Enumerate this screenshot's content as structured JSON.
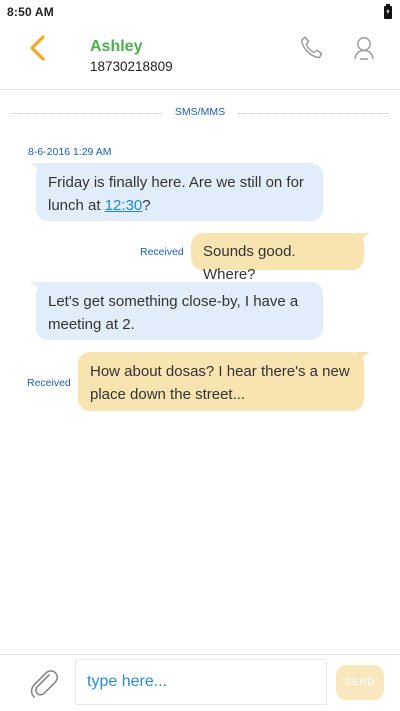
{
  "status_bar": {
    "time": "8:50 AM",
    "icons": [
      "battery-charging-icon"
    ]
  },
  "header": {
    "contact_name": "Ashley",
    "contact_number": "18730218809",
    "icons": [
      "chevron-left-icon",
      "phone-icon",
      "person-icon"
    ]
  },
  "conversation": {
    "section_label": "SMS/MMS",
    "date_label": "8-6-2016 1:29 AM",
    "messages": [
      {
        "direction": "incoming",
        "text_before_link": "Friday is finally here. Are we still on for lunch at ",
        "link": "12:30",
        "text_after_link": "?"
      },
      {
        "direction": "outgoing",
        "status": "Received",
        "text": "Sounds good. Where?"
      },
      {
        "direction": "incoming",
        "text": "Let's get something close-by, I have a meeting at 2."
      },
      {
        "direction": "outgoing",
        "status": "Received",
        "text": "How about dosas? I hear there's a new place down the street..."
      }
    ]
  },
  "composer": {
    "placeholder": "type here...",
    "send_label": "SEND",
    "icons": [
      "paperclip-icon"
    ]
  },
  "colors": {
    "accent_orange": "#f5a623",
    "contact_green": "#4caf50",
    "link_blue": "#1a88d6",
    "meta_blue": "#1a5fb4",
    "incoming_bubble": "#e1eef9",
    "outgoing_bubble": "#f8e4b0",
    "send_button": "#f9e7bd"
  }
}
